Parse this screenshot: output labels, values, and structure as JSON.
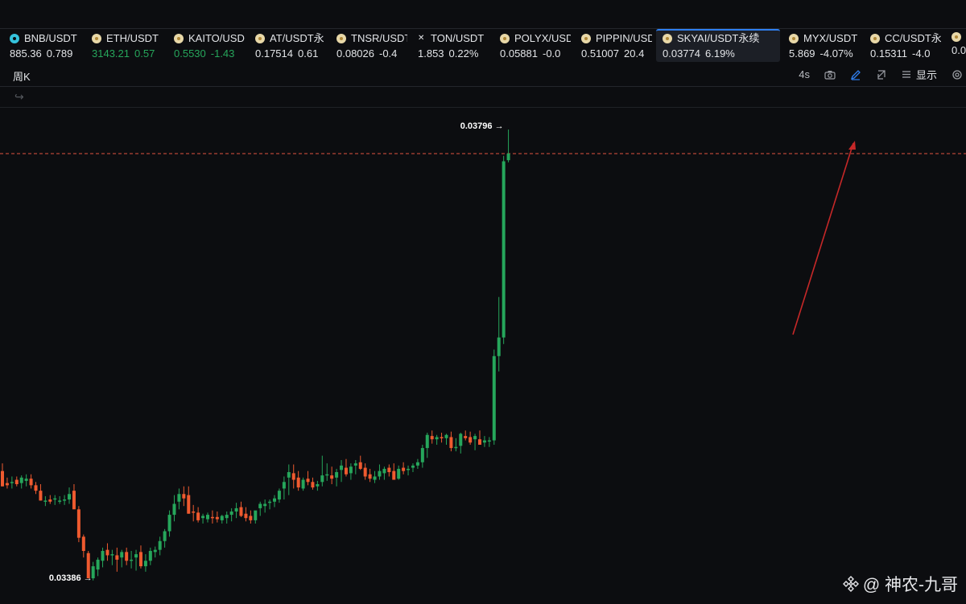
{
  "tickers": [
    {
      "symbol": "BNB/USDT",
      "price": "885.36",
      "change": "0.789",
      "icon": "bnb-coin-icon",
      "up": false
    },
    {
      "symbol": "ETH/USDT",
      "price": "3143.21",
      "change": "0.57",
      "icon": "eth-coin-icon",
      "up": true
    },
    {
      "symbol": "KAITO/USDT",
      "price": "0.5530",
      "change": "-1.43",
      "icon": "kaito-coin-icon",
      "up": true
    },
    {
      "symbol": "AT/USDT永",
      "price": "0.17514",
      "change": "0.61",
      "icon": "at-coin-icon",
      "up": false
    },
    {
      "symbol": "TNSR/USDT",
      "price": "0.08026",
      "change": "-0.4",
      "icon": "tnsr-coin-icon",
      "up": false
    },
    {
      "symbol": "TON/USDT",
      "price": "1.853",
      "change": "0.22%",
      "icon": "x-icon",
      "up": false
    },
    {
      "symbol": "POLYX/USDT",
      "price": "0.05881",
      "change": "-0.0",
      "icon": "polyx-coin-icon",
      "up": false
    },
    {
      "symbol": "PIPPIN/USDT",
      "price": "0.51007",
      "change": "20.4",
      "icon": "pippin-coin-icon",
      "up": false
    },
    {
      "symbol": "SKYAI/USDT永续",
      "price": "0.03774",
      "change": "6.19%",
      "icon": "skyai-coin-icon",
      "up": false,
      "active": true
    },
    {
      "symbol": "MYX/USDT",
      "price": "5.869",
      "change": "-4.07%",
      "icon": "myx-coin-icon",
      "up": false
    },
    {
      "symbol": "CC/USDT永",
      "price": "0.15311",
      "change": "-4.0",
      "icon": "cc-coin-icon",
      "up": false
    },
    {
      "symbol": "",
      "price": "0.0",
      "change": "",
      "icon": "coin-icon",
      "up": false
    }
  ],
  "toolbar": {
    "interval": "周K",
    "refresh": "4s",
    "display_label": "显示",
    "icons": [
      "camera-icon",
      "draw-icon",
      "expand-icon",
      "list-icon",
      "settings-icon"
    ]
  },
  "chart_data": {
    "type": "candlestick",
    "symbol": "SKYAI/USDT永续",
    "interval": "周K",
    "high_label": "0.03796 →",
    "low_label": "0.03386 →",
    "high_value": 0.03796,
    "low_value": 0.03386,
    "last_price_line": 0.03774,
    "annotation": "red trend arrow pointing up",
    "colors": {
      "up": "#26a65b",
      "down": "#ef5a2f",
      "last_line": "#e0533f",
      "arrow": "#c62828"
    },
    "candles": [
      [
        0.03484,
        0.03491,
        0.0347,
        0.0347
      ],
      [
        0.03473,
        0.03478,
        0.03468,
        0.03471
      ],
      [
        0.03473,
        0.03479,
        0.03468,
        0.03474
      ],
      [
        0.03476,
        0.03479,
        0.0347,
        0.03472
      ],
      [
        0.03473,
        0.0348,
        0.03468,
        0.03478
      ],
      [
        0.03475,
        0.03481,
        0.0347,
        0.03477
      ],
      [
        0.03477,
        0.03481,
        0.03468,
        0.03471
      ],
      [
        0.03471,
        0.03474,
        0.03463,
        0.03466
      ],
      [
        0.03466,
        0.03472,
        0.03457,
        0.03457
      ],
      [
        0.03456,
        0.03461,
        0.03452,
        0.03457
      ],
      [
        0.03458,
        0.03462,
        0.03454,
        0.03456
      ],
      [
        0.03458,
        0.03462,
        0.03453,
        0.03459
      ],
      [
        0.03457,
        0.03461,
        0.03454,
        0.03457
      ],
      [
        0.03457,
        0.03462,
        0.03453,
        0.03458
      ],
      [
        0.03458,
        0.03469,
        0.03454,
        0.03463
      ],
      [
        0.03466,
        0.03472,
        0.03456,
        0.03449
      ],
      [
        0.03449,
        0.03452,
        0.03419,
        0.03423
      ],
      [
        0.03424,
        0.03426,
        0.03405,
        0.03411
      ],
      [
        0.03409,
        0.03411,
        0.03387,
        0.03386
      ],
      [
        0.03386,
        0.03401,
        0.03384,
        0.03397
      ],
      [
        0.03394,
        0.03405,
        0.03388,
        0.03403
      ],
      [
        0.03402,
        0.03414,
        0.03396,
        0.03411
      ],
      [
        0.03412,
        0.03418,
        0.03402,
        0.03407
      ],
      [
        0.03407,
        0.03412,
        0.03398,
        0.03408
      ],
      [
        0.03407,
        0.03414,
        0.03392,
        0.03403
      ],
      [
        0.03405,
        0.03412,
        0.03396,
        0.0341
      ],
      [
        0.0341,
        0.03414,
        0.03398,
        0.03402
      ],
      [
        0.03402,
        0.03411,
        0.03395,
        0.03403
      ],
      [
        0.03405,
        0.03412,
        0.03393,
        0.03408
      ],
      [
        0.0341,
        0.03416,
        0.03395,
        0.03397
      ],
      [
        0.03397,
        0.03408,
        0.03392,
        0.03402
      ],
      [
        0.03402,
        0.03414,
        0.03398,
        0.03411
      ],
      [
        0.0341,
        0.03415,
        0.03405,
        0.03412
      ],
      [
        0.03412,
        0.03424,
        0.03407,
        0.0342
      ],
      [
        0.0342,
        0.03431,
        0.03414,
        0.03429
      ],
      [
        0.03429,
        0.03448,
        0.03424,
        0.03444
      ],
      [
        0.03444,
        0.03462,
        0.03438,
        0.03454
      ],
      [
        0.03456,
        0.03468,
        0.03449,
        0.03463
      ],
      [
        0.03463,
        0.0347,
        0.03452,
        0.03459
      ],
      [
        0.03462,
        0.0347,
        0.03445,
        0.03445
      ],
      [
        0.03447,
        0.03453,
        0.03438,
        0.03446
      ],
      [
        0.03446,
        0.03451,
        0.03437,
        0.03439
      ],
      [
        0.03441,
        0.03445,
        0.03436,
        0.03443
      ],
      [
        0.0344,
        0.03446,
        0.03437,
        0.03444
      ],
      [
        0.03442,
        0.03448,
        0.03436,
        0.03441
      ],
      [
        0.03442,
        0.03447,
        0.03437,
        0.0344
      ],
      [
        0.03439,
        0.03444,
        0.03436,
        0.03443
      ],
      [
        0.03441,
        0.03447,
        0.03436,
        0.03444
      ],
      [
        0.03444,
        0.0345,
        0.03438,
        0.03447
      ],
      [
        0.03447,
        0.03455,
        0.03441,
        0.0345
      ],
      [
        0.03451,
        0.03456,
        0.03442,
        0.03443
      ],
      [
        0.03445,
        0.03451,
        0.03438,
        0.03441
      ],
      [
        0.03443,
        0.03448,
        0.03436,
        0.03439
      ],
      [
        0.03439,
        0.03447,
        0.03436,
        0.03448
      ],
      [
        0.0345,
        0.03456,
        0.03443,
        0.03454
      ],
      [
        0.03452,
        0.03458,
        0.03446,
        0.03454
      ],
      [
        0.03455,
        0.03458,
        0.03449,
        0.03456
      ],
      [
        0.03456,
        0.03462,
        0.03451,
        0.03459
      ],
      [
        0.03458,
        0.03468,
        0.03455,
        0.03466
      ],
      [
        0.03468,
        0.03479,
        0.03458,
        0.03474
      ],
      [
        0.03478,
        0.0349,
        0.03462,
        0.03483
      ],
      [
        0.03482,
        0.0349,
        0.03468,
        0.03476
      ],
      [
        0.03478,
        0.03484,
        0.03466,
        0.03469
      ],
      [
        0.03468,
        0.03478,
        0.03466,
        0.03476
      ],
      [
        0.03477,
        0.03484,
        0.03471,
        0.03474
      ],
      [
        0.03474,
        0.03478,
        0.03467,
        0.03469
      ],
      [
        0.0347,
        0.03475,
        0.03466,
        0.03472
      ],
      [
        0.03474,
        0.03498,
        0.0347,
        0.0348
      ],
      [
        0.0348,
        0.03491,
        0.03475,
        0.03481
      ],
      [
        0.0348,
        0.03488,
        0.03472,
        0.03477
      ],
      [
        0.03478,
        0.03486,
        0.0347,
        0.03483
      ],
      [
        0.03485,
        0.03494,
        0.03474,
        0.03489
      ],
      [
        0.03487,
        0.03495,
        0.03479,
        0.03481
      ],
      [
        0.03482,
        0.03491,
        0.03476,
        0.03488
      ],
      [
        0.03489,
        0.03494,
        0.03481,
        0.03491
      ],
      [
        0.03492,
        0.03498,
        0.03485,
        0.03486
      ],
      [
        0.03487,
        0.03491,
        0.03476,
        0.03479
      ],
      [
        0.03481,
        0.03486,
        0.03474,
        0.03477
      ],
      [
        0.03476,
        0.03484,
        0.03473,
        0.03479
      ],
      [
        0.03479,
        0.0349,
        0.03476,
        0.03484
      ],
      [
        0.03482,
        0.03488,
        0.03476,
        0.03486
      ],
      [
        0.03487,
        0.0349,
        0.03479,
        0.03483
      ],
      [
        0.03484,
        0.03491,
        0.03477,
        0.03476
      ],
      [
        0.03477,
        0.03489,
        0.03476,
        0.03486
      ],
      [
        0.03487,
        0.03492,
        0.03481,
        0.03484
      ],
      [
        0.03485,
        0.03489,
        0.0348,
        0.03486
      ],
      [
        0.03487,
        0.03491,
        0.03483,
        0.03489
      ],
      [
        0.03489,
        0.03495,
        0.03486,
        0.03492
      ],
      [
        0.03492,
        0.03508,
        0.03487,
        0.03505
      ],
      [
        0.03505,
        0.03519,
        0.03496,
        0.03517
      ],
      [
        0.03516,
        0.03521,
        0.03509,
        0.03513
      ],
      [
        0.03513,
        0.03517,
        0.03508,
        0.03515
      ],
      [
        0.03515,
        0.03519,
        0.0351,
        0.03514
      ],
      [
        0.03514,
        0.03518,
        0.03508,
        0.03517
      ],
      [
        0.03515,
        0.0352,
        0.03502,
        0.03505
      ],
      [
        0.03505,
        0.03514,
        0.03502,
        0.03506
      ],
      [
        0.03507,
        0.03519,
        0.035,
        0.03518
      ],
      [
        0.03516,
        0.03521,
        0.03512,
        0.03514
      ],
      [
        0.03515,
        0.0352,
        0.03508,
        0.0351
      ],
      [
        0.03513,
        0.03518,
        0.03503,
        0.03516
      ],
      [
        0.03513,
        0.03521,
        0.03508,
        0.03508
      ],
      [
        0.0351,
        0.03516,
        0.03506,
        0.03512
      ],
      [
        0.03512,
        0.03515,
        0.03506,
        0.03512
      ],
      [
        0.03512,
        0.03595,
        0.03508,
        0.03589
      ],
      [
        0.03589,
        0.03643,
        0.03575,
        0.03606
      ],
      [
        0.03606,
        0.03772,
        0.036,
        0.03767
      ],
      [
        0.03768,
        0.03796,
        0.03766,
        0.03774
      ]
    ]
  }
}
